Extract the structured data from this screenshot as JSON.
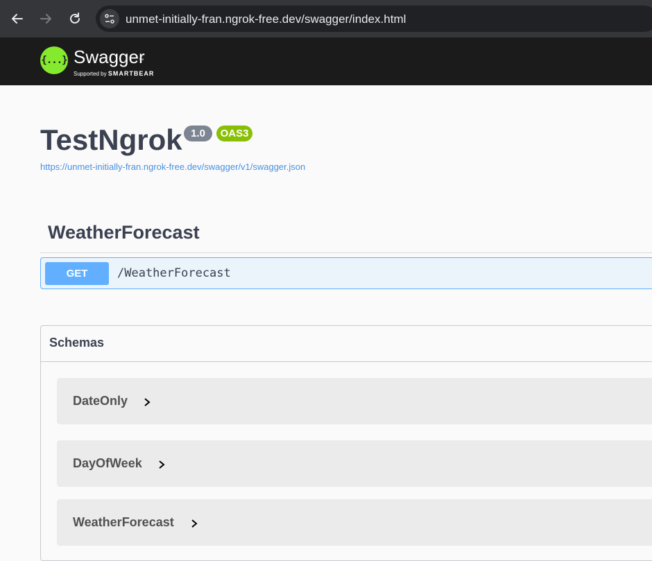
{
  "browser": {
    "url": "unmet-initially-fran.ngrok-free.dev/swagger/index.html"
  },
  "topbar": {
    "logo_symbol": "{...}",
    "logo_title": "Swagger",
    "logo_tm": "™",
    "supported_by": "Supported by",
    "smartbear": "SMARTBEAR"
  },
  "info": {
    "title": "TestNgrok",
    "version": "1.0",
    "oas": "OAS3",
    "spec_url": "https://unmet-initially-fran.ngrok-free.dev/swagger/v1/swagger.json"
  },
  "tag": {
    "name": "WeatherForecast",
    "operations": [
      {
        "method": "GET",
        "path": "/WeatherForecast"
      }
    ]
  },
  "schemas": {
    "title": "Schemas",
    "models": [
      {
        "name": "DateOnly"
      },
      {
        "name": "DayOfWeek"
      },
      {
        "name": "WeatherForecast"
      }
    ]
  },
  "colors": {
    "get_method": "#61affe",
    "oas_badge": "#89bf04",
    "version_badge": "#7d8492",
    "swagger_green": "#85ea2d"
  }
}
